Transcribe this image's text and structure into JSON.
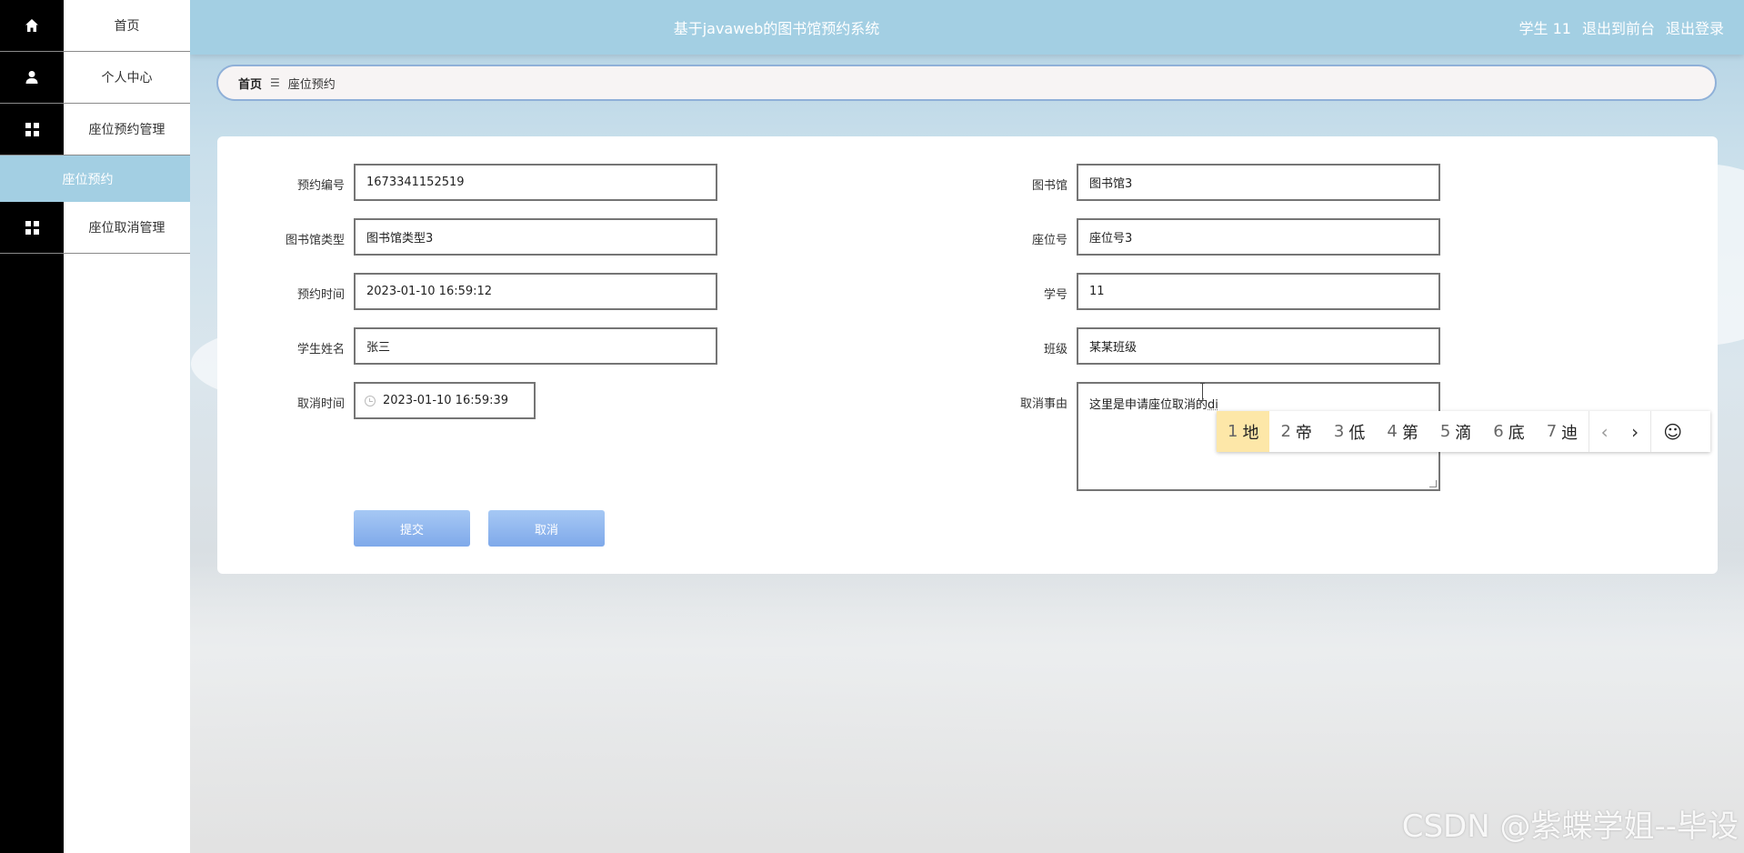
{
  "header": {
    "title": "基于javaweb的图书馆预约系统",
    "user_label": "学生 11",
    "back_to_front": "退出到前台",
    "logout": "退出登录"
  },
  "sidebar": {
    "items": [
      {
        "label": "首页",
        "icon": "home-icon"
      },
      {
        "label": "个人中心",
        "icon": "user-icon"
      },
      {
        "label": "座位预约管理",
        "icon": "grid-icon"
      },
      {
        "label": "座位取消管理",
        "icon": "grid-icon"
      }
    ],
    "active_sub": "座位预约"
  },
  "breadcrumb": {
    "home": "首页",
    "separator": "☰",
    "current": "座位预约"
  },
  "form": {
    "reservation_no": {
      "label": "预约编号",
      "value": "1673341152519"
    },
    "library": {
      "label": "图书馆",
      "value": "图书馆3"
    },
    "library_type": {
      "label": "图书馆类型",
      "value": "图书馆类型3"
    },
    "seat_no": {
      "label": "座位号",
      "value": "座位号3"
    },
    "reserve_time": {
      "label": "预约时间",
      "value": "2023-01-10 16:59:12"
    },
    "student_no": {
      "label": "学号",
      "value": "11"
    },
    "student_name": {
      "label": "学生姓名",
      "value": "张三"
    },
    "class": {
      "label": "班级",
      "value": "某某班级"
    },
    "cancel_time": {
      "label": "取消时间",
      "value": "2023-01-10 16:59:39"
    },
    "cancel_reason": {
      "label": "取消事由",
      "value": "这里是申请座位取消的",
      "composing": "di"
    },
    "submit_label": "提交",
    "cancel_label": "取消"
  },
  "ime": {
    "candidates": [
      {
        "num": "1",
        "char": "地"
      },
      {
        "num": "2",
        "char": "帝"
      },
      {
        "num": "3",
        "char": "低"
      },
      {
        "num": "4",
        "char": "第"
      },
      {
        "num": "5",
        "char": "滴"
      },
      {
        "num": "6",
        "char": "底"
      },
      {
        "num": "7",
        "char": "迪"
      }
    ],
    "prev": "‹",
    "next": "›",
    "emoji": "☺"
  },
  "watermark": "CSDN @紫蝶学姐--毕设",
  "colors": {
    "header_bg": "#a3cfe3",
    "sidebar_rail": "#000000",
    "active_sub_bg": "#a3cfe3",
    "button": "#7fa9ea",
    "ime_highlight": "#fde7a8"
  }
}
